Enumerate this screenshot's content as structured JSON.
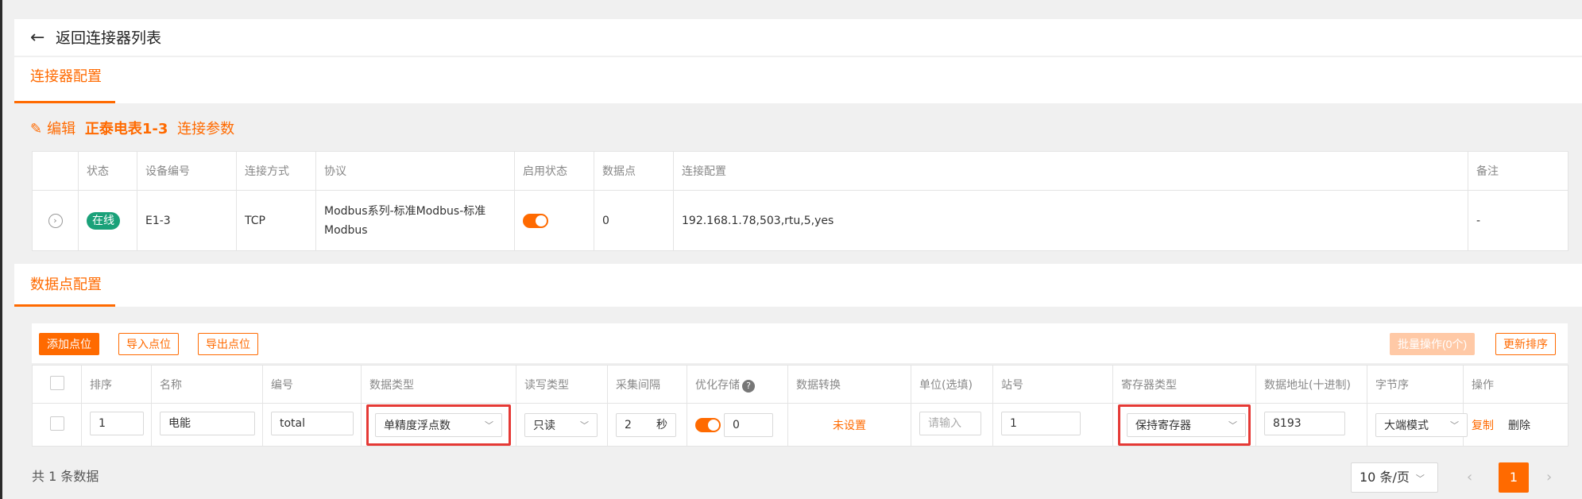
{
  "back": {
    "label": "返回连接器列表"
  },
  "tabs": {
    "connector": "连接器配置",
    "points": "数据点配置"
  },
  "edit": {
    "prefix": "编辑",
    "device": "正泰电表1-3",
    "suffix": "连接参数"
  },
  "connector_table": {
    "headers": [
      "状态",
      "设备编号",
      "连接方式",
      "协议",
      "启用状态",
      "数据点",
      "连接配置",
      "备注"
    ],
    "row": {
      "status": "在线",
      "device_id": "E1-3",
      "connection": "TCP",
      "protocol": "Modbus系列-标准Modbus-标准Modbus",
      "enabled": true,
      "points": "0",
      "config": "192.168.1.78,503,rtu,5,yes",
      "remark": "-"
    }
  },
  "toolbar": {
    "add": "添加点位",
    "import": "导入点位",
    "export": "导出点位",
    "batch": "批量操作(0个)",
    "reorder": "更新排序"
  },
  "points_table": {
    "headers": [
      "排序",
      "名称",
      "编号",
      "数据类型",
      "读写类型",
      "采集间隔",
      "优化存储",
      "数据转换",
      "单位(选填)",
      "站号",
      "寄存器类型",
      "数据地址(十进制)",
      "字节序",
      "操作"
    ],
    "row": {
      "order": "1",
      "name": "电能",
      "code": "total",
      "data_type": "单精度浮点数",
      "rw_type": "只读",
      "interval": "2",
      "interval_unit": "秒",
      "optimize_enabled": true,
      "optimize_value": "0",
      "conversion": "未设置",
      "unit_placeholder": "请输入",
      "station": "1",
      "register_type": "保持寄存器",
      "address": "8193",
      "byte_order": "大端模式",
      "action_copy": "复制",
      "action_delete": "删除"
    }
  },
  "pagination": {
    "total": "共 1 条数据",
    "page_size": "10 条/页",
    "current": "1",
    "prev": "‹",
    "next": "›"
  },
  "colors": {
    "accent": "#ff6a00",
    "online": "#1aa179",
    "highlight": "#e53935"
  }
}
